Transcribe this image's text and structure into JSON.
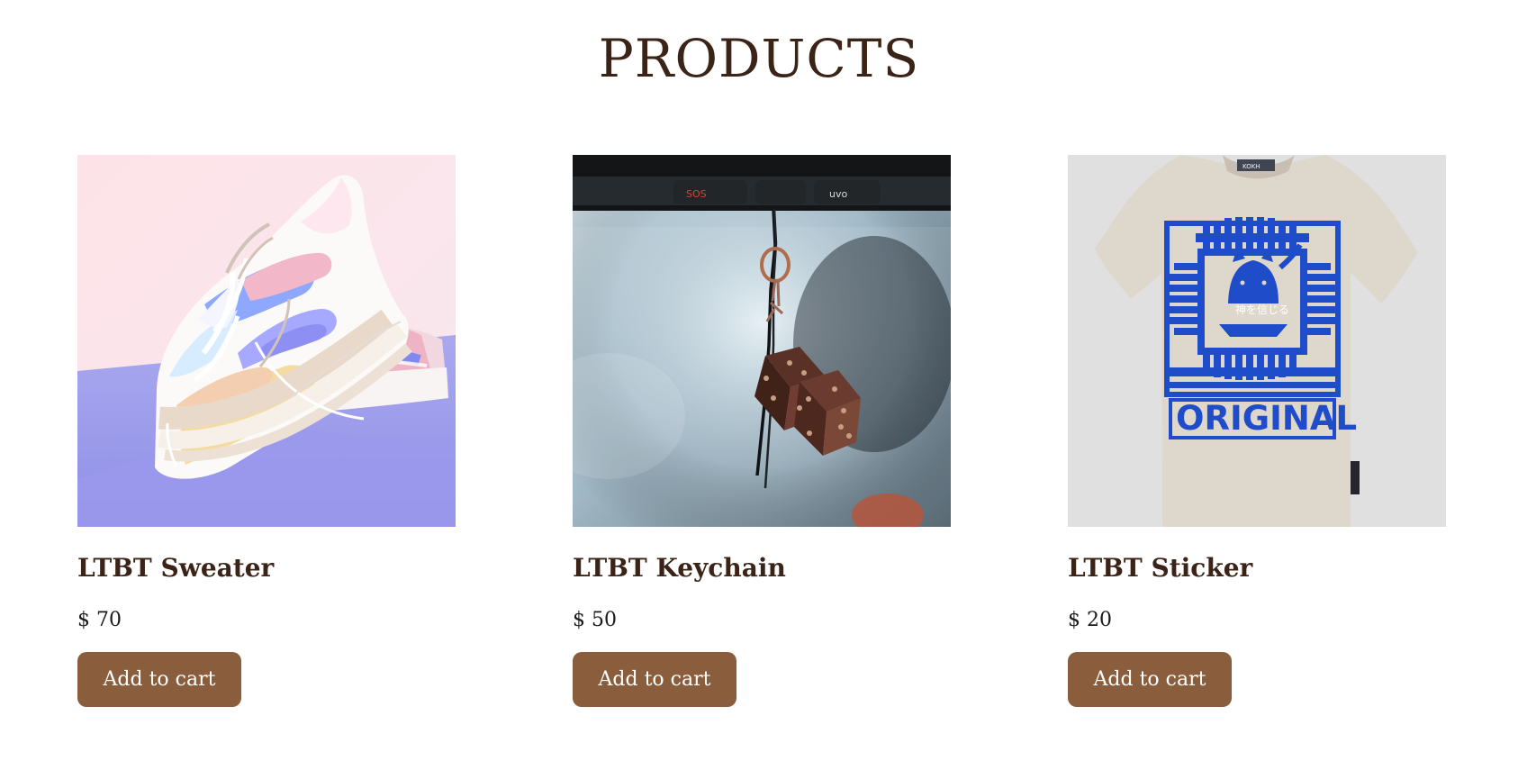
{
  "page": {
    "title": "PRODUCTS"
  },
  "products": [
    {
      "name": "LTBT Sweater",
      "price": "$ 70",
      "button_label": "Add to cart",
      "image_semantic": "sneaker-image"
    },
    {
      "name": "LTBT Keychain",
      "price": "$ 50",
      "button_label": "Add to cart",
      "image_semantic": "dice-keychain-image",
      "image_text": {
        "left": "SOS",
        "right": "uvo"
      }
    },
    {
      "name": "LTBT Sticker",
      "price": "$ 20",
      "button_label": "Add to cart",
      "image_semantic": "tshirt-image",
      "image_text": {
        "main": "ORIGINAL",
        "sub": "神を信じる",
        "tag": "KOKH"
      }
    }
  ],
  "colors": {
    "title": "#3b2417",
    "button_bg": "#8a5e3d",
    "button_text": "#ffffff"
  }
}
